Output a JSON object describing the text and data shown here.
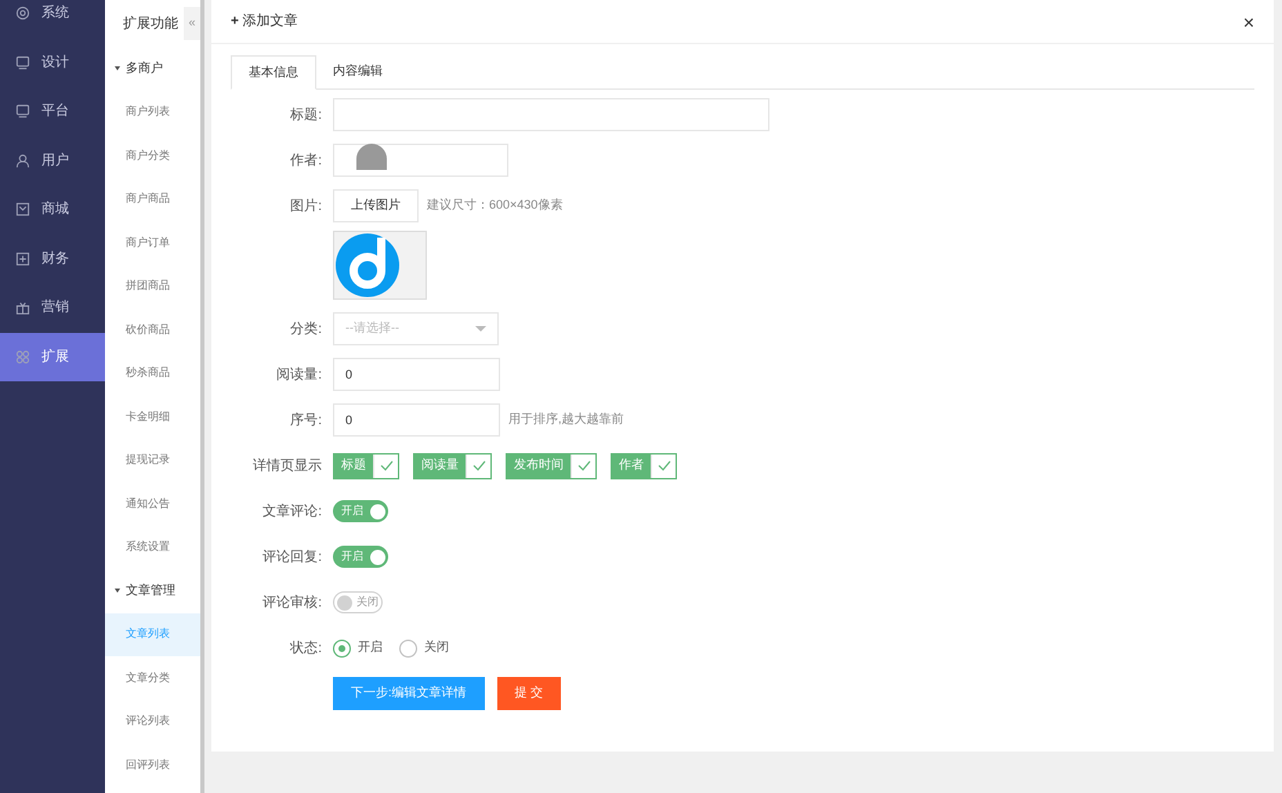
{
  "nav": {
    "items": [
      {
        "label": "系统",
        "selected": false
      },
      {
        "label": "设计",
        "selected": false
      },
      {
        "label": "平台",
        "selected": false
      },
      {
        "label": "用户",
        "selected": false
      },
      {
        "label": "商城",
        "selected": false
      },
      {
        "label": "财务",
        "selected": false
      },
      {
        "label": "营销",
        "selected": false
      },
      {
        "label": "扩展",
        "selected": true
      }
    ]
  },
  "subnav": {
    "title": "扩展功能",
    "collapse": "«",
    "groups": [
      {
        "label": "多商户",
        "expanded": true,
        "children": [
          {
            "label": "商户列表",
            "selected": false
          },
          {
            "label": "商户分类",
            "selected": false
          },
          {
            "label": "商户商品",
            "selected": false
          },
          {
            "label": "商户订单",
            "selected": false
          },
          {
            "label": "拼团商品",
            "selected": false
          },
          {
            "label": "砍价商品",
            "selected": false
          },
          {
            "label": "秒杀商品",
            "selected": false
          },
          {
            "label": "卡金明细",
            "selected": false
          },
          {
            "label": "提现记录",
            "selected": false
          },
          {
            "label": "通知公告",
            "selected": false
          },
          {
            "label": "系统设置",
            "selected": false
          }
        ]
      },
      {
        "label": "文章管理",
        "expanded": true,
        "children": [
          {
            "label": "文章列表",
            "selected": true
          },
          {
            "label": "文章分类",
            "selected": false
          },
          {
            "label": "评论列表",
            "selected": false
          },
          {
            "label": "回评列表",
            "selected": false
          }
        ]
      }
    ]
  },
  "dialog": {
    "title": "添加文章",
    "title_icon": "+",
    "close": "×",
    "tabs": [
      {
        "label": "基本信息",
        "selected": true
      },
      {
        "label": "内容编辑",
        "selected": false
      }
    ],
    "rows": [
      {
        "kind": "text",
        "label": "标题:"
      },
      {
        "kind": "redacted",
        "label": "作者:"
      },
      {
        "kind": "upload",
        "label": "图片:",
        "button": "上传图片",
        "hint": "建议尺寸：600×430像素"
      },
      {
        "kind": "select",
        "label": "分类:",
        "placeholder": "--请选择--"
      },
      {
        "kind": "input",
        "label": "阅读量:",
        "value": "0"
      },
      {
        "kind": "input",
        "label": "序号:",
        "value": "0",
        "hint": "用于排序,越大越靠前"
      },
      {
        "kind": "checks",
        "label": "详情页显示",
        "options": [
          {
            "label": "标题",
            "checked": true
          },
          {
            "label": "阅读量",
            "checked": true
          },
          {
            "label": "发布时间",
            "checked": true
          },
          {
            "label": "作者",
            "checked": true
          }
        ]
      },
      {
        "kind": "switch",
        "label": "文章评论:",
        "on": true,
        "text": "开启"
      },
      {
        "kind": "switch",
        "label": "评论回复:",
        "on": true,
        "text": "开启"
      },
      {
        "kind": "switch",
        "label": "评论审核:",
        "on": false,
        "text": "关闭"
      },
      {
        "kind": "radio",
        "label": "状态:",
        "options": [
          {
            "label": "开启",
            "selected": true
          },
          {
            "label": "关闭",
            "selected": false
          }
        ]
      }
    ],
    "buttons": [
      {
        "label": "下一步:编辑文章详情",
        "kind": "primary"
      },
      {
        "label": "提 交",
        "kind": "danger"
      }
    ]
  }
}
